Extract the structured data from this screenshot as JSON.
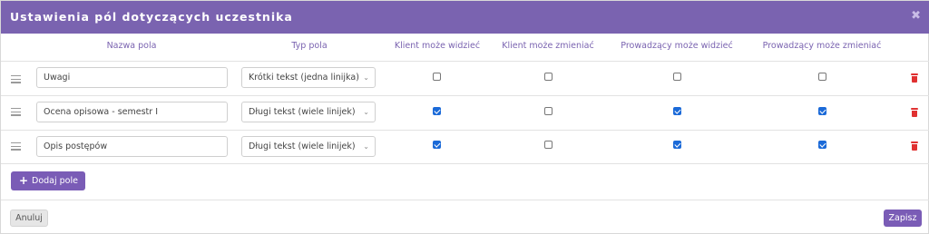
{
  "dialog": {
    "title": "Ustawienia pól dotyczących uczestnika",
    "close_glyph": "✖"
  },
  "columns": {
    "name": "Nazwa pola",
    "type": "Typ pola",
    "client_view": "Klient może widzieć",
    "client_edit": "Klient może zmieniać",
    "host_view": "Prowadzący może widzieć",
    "host_edit": "Prowadzący może zmieniać"
  },
  "rows": [
    {
      "name": "Uwagi",
      "type": "Krótki tekst (jedna linijka)",
      "client_view": false,
      "client_edit": false,
      "host_view": false,
      "host_edit": false
    },
    {
      "name": "Ocena opisowa - semestr I",
      "type": "Długi tekst (wiele linijek)",
      "client_view": true,
      "client_edit": false,
      "host_view": true,
      "host_edit": true
    },
    {
      "name": "Opis postępów",
      "type": "Długi tekst (wiele linijek)",
      "client_view": true,
      "client_edit": false,
      "host_view": true,
      "host_edit": true
    }
  ],
  "buttons": {
    "add_field": "Dodaj pole",
    "cancel": "Anuluj",
    "save": "Zapisz"
  },
  "icons": {
    "drag": "drag-handle-icon",
    "chevron": "chevron-down-icon",
    "delete": "trash-icon",
    "add": "plus-icon"
  },
  "colors": {
    "accent": "#7a63b0",
    "checkbox_checked": "#1b6ad8",
    "delete": "#e03131"
  }
}
